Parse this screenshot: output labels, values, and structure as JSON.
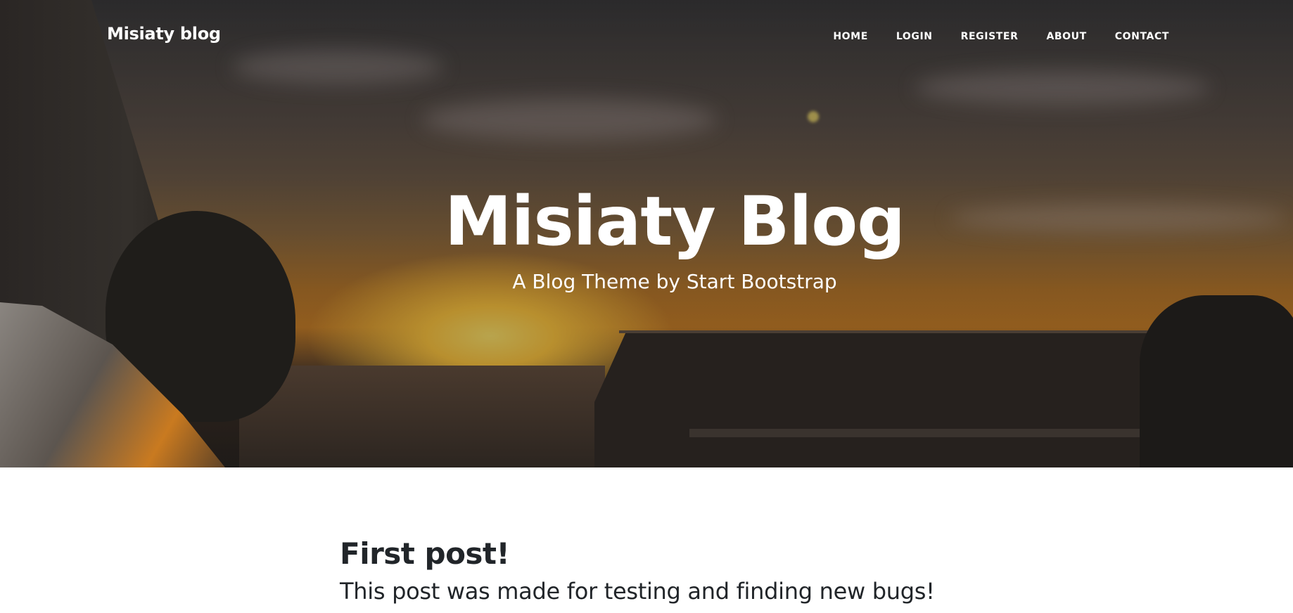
{
  "navbar": {
    "brand": "Misiaty blog",
    "links": [
      {
        "label": "HOME"
      },
      {
        "label": "LOGIN"
      },
      {
        "label": "REGISTER"
      },
      {
        "label": "ABOUT"
      },
      {
        "label": "CONTACT"
      }
    ]
  },
  "hero": {
    "title": "Misiaty Blog",
    "subtitle": "A Blog Theme by Start Bootstrap"
  },
  "posts": [
    {
      "title": "First post!",
      "subtitle": "This post was made for testing and finding new bugs!"
    }
  ],
  "colors": {
    "text_dark": "#212529",
    "nav_text": "#ffffff",
    "sunset_orange": "#c9802a"
  }
}
